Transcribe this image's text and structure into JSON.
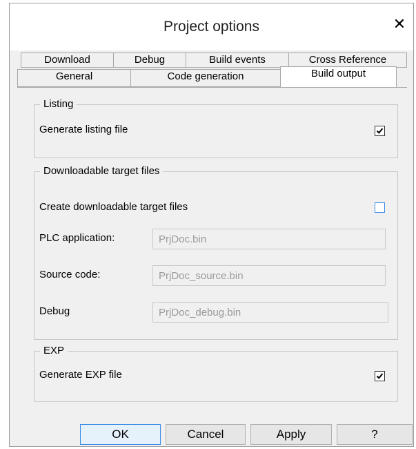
{
  "dialog": {
    "title": "Project options",
    "close_glyph": "✕"
  },
  "tabs": {
    "row1": [
      "Download",
      "Debug",
      "Build events",
      "Cross Reference"
    ],
    "row2": [
      "General",
      "Code generation",
      "Build output"
    ],
    "active": "Build output"
  },
  "listing": {
    "legend": "Listing",
    "generate_label": "Generate listing file",
    "generate_checked": true
  },
  "downloadable": {
    "legend": "Downloadable target files",
    "create_label": "Create downloadable target files",
    "create_checked": false,
    "plc_label": "PLC application:",
    "plc_value": "PrjDoc.bin",
    "source_label": "Source code:",
    "source_value": "PrjDoc_source.bin",
    "debug_label": "Debug",
    "debug_value": "PrjDoc_debug.bin"
  },
  "exp": {
    "legend": "EXP",
    "generate_label": "Generate EXP file",
    "generate_checked": true
  },
  "buttons": {
    "ok": "OK",
    "cancel": "Cancel",
    "apply": "Apply",
    "help": "?"
  },
  "icons": {
    "check": "check-icon",
    "close": "close-icon"
  }
}
